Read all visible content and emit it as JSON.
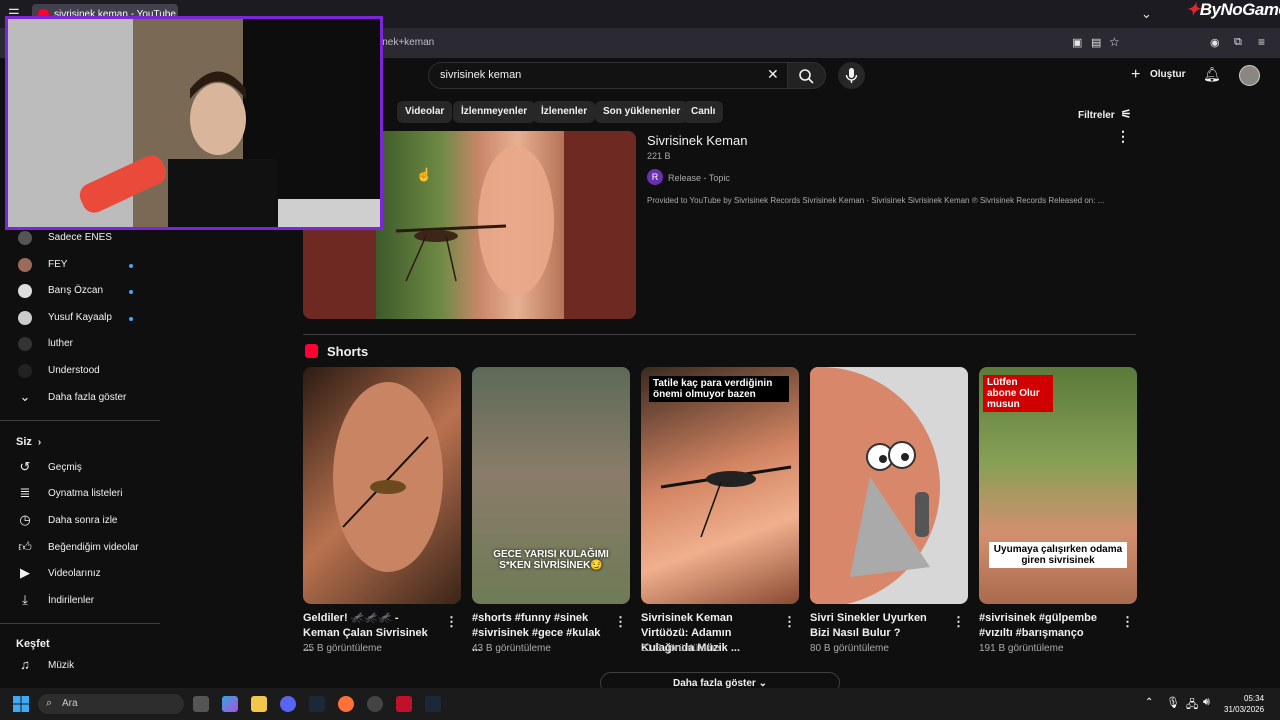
{
  "browser": {
    "tab_title": "sivrisinek keman - YouTube",
    "url_fragment": "inek+keman",
    "logo_text": "ByNoGame"
  },
  "header": {
    "search_value": "sivrisinek keman",
    "create_label": "Oluştur"
  },
  "chips": [
    "Videolar",
    "İzlenmeyenler",
    "İzlenenler",
    "Son yüklenenler",
    "Canlı"
  ],
  "filters_label": "Filtreler",
  "sidebar": {
    "subscriptions": [
      {
        "label": "Sadece ENES",
        "dot": false
      },
      {
        "label": "FEY",
        "dot": true
      },
      {
        "label": "Barış Özcan",
        "dot": true
      },
      {
        "label": "Yusuf Kayaalp",
        "dot": true
      },
      {
        "label": "luther",
        "dot": false
      },
      {
        "label": "Understood",
        "dot": false
      }
    ],
    "show_more": "Daha fazla göster",
    "you_heading": "Siz",
    "you_items": [
      "Geçmiş",
      "Oynatma listeleri",
      "Daha sonra izle",
      "Beğendiğim videolar",
      "Videolarınız",
      "İndirilenler"
    ],
    "explore_heading": "Keşfet",
    "explore_items": [
      "Müzik"
    ]
  },
  "result": {
    "title": "Sivrisinek Keman",
    "views": "221 B",
    "channel_initial": "R",
    "channel": "Release - Topic",
    "description": "Provided to YouTube by Sivrisinek Records Sivrisinek Keman · Sivrisinek Sivrisinek Keman ℗ Sivrisinek Records Released on: ..."
  },
  "shorts": {
    "heading": "Shorts",
    "items": [
      {
        "title": "Geldiler! 🦟🦟🦟 - Keman Çalan Sivrisinek ...",
        "views": "25 B görüntüleme",
        "overlay": ""
      },
      {
        "title": "#shorts #funny #sinek #sivrisinek #gece #kulak ...",
        "views": "43 B görüntüleme",
        "overlay": "GECE YARISI KULAĞIMI S*KEN SİVRİSİNEK😏"
      },
      {
        "title": "Sivrisinek Keman Virtüözü: Adamın Kulağında Müzik ...",
        "views": "21 B görüntüleme",
        "overlay": "Tatile kaç para verdiğinin önemi olmuyor bazen"
      },
      {
        "title": "Sivri Sinekler Uyurken Bizi Nasıl Bulur ?",
        "views": "80 B görüntüleme",
        "overlay": ""
      },
      {
        "title": "#sivrisinek #gülpembe #vızıltı #barışmanço",
        "views": "191 B görüntüleme",
        "overlay": "Lütfen abone Olur musun",
        "overlay2": "Uyumaya çalışırken odama giren sivrisinek"
      }
    ],
    "more_label": "Daha fazla göster"
  },
  "taskbar": {
    "search_label": "Ara",
    "time": "05:34",
    "date": "31/03/2026"
  },
  "colors": {
    "accent": "#3ea6ff",
    "webcam_border": "#7c25d9",
    "shorts_red": "#ff0033"
  }
}
